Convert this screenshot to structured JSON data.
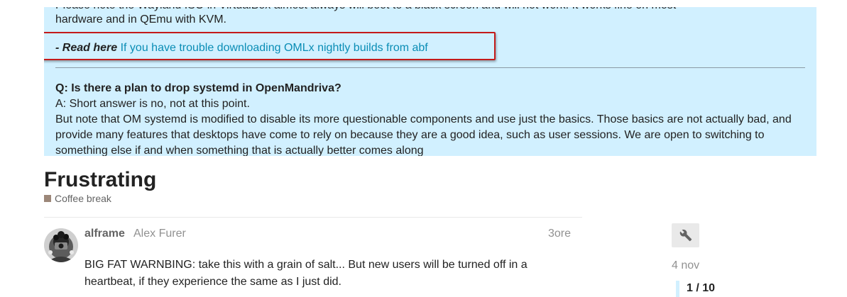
{
  "banner": {
    "line_cut": "Please note the Wayland ISO in VirtualBox almost always will boot to a black screen and will not work. It works fine on most",
    "line2": "hardware and in QEmu with KVM.",
    "read_here_prefix": "- Read here",
    "read_here_link": "If you have trouble downloading OMLx nightly builds from abf",
    "question": "Q: Is there a plan to drop systemd in OpenMandriva?",
    "answer": "A: Short answer is no, not at this point.",
    "paragraph": "But note that OM systemd is modified to disable its more questionable components and use just the basics. Those basics are not actually bad, and provide many features that desktops have come to rely on because they are a good idea, such as user sessions. We are open to switching to something else if and when something that is actually better comes along"
  },
  "topic": {
    "title": "Frustrating",
    "category": "Coffee break"
  },
  "post": {
    "username": "alframe",
    "full_name": "Alex Furer",
    "age": "3ore",
    "body": "BIG FAT WARNBING: take this with a grain of salt... But new users will be turned off in a heartbeat, if they experience the same as I just did."
  },
  "timeline": {
    "date": "4 nov",
    "count": "1 / 10"
  },
  "colors": {
    "banner_bg": "#d1f0ff",
    "link": "#0a8db5",
    "highlight_box": "#c41a1a",
    "category": "#9c8779"
  },
  "icons": {
    "admin": "wrench-icon"
  }
}
